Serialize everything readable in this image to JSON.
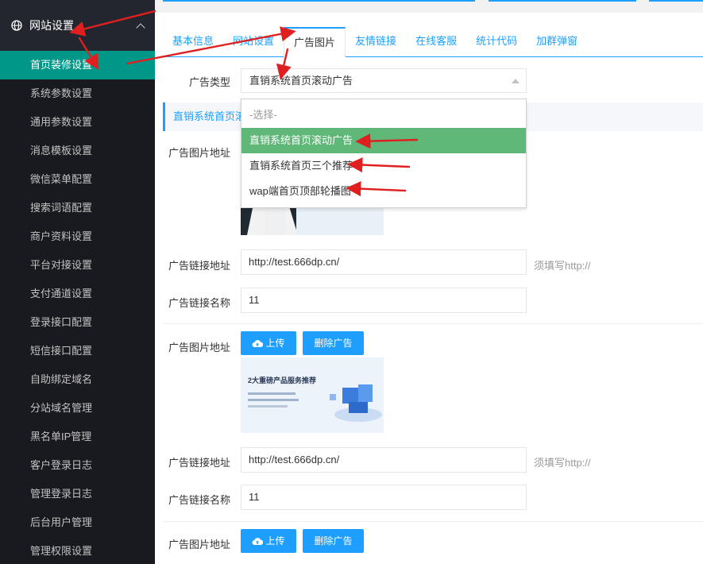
{
  "sidebar": {
    "group_label": "网站设置",
    "items": [
      {
        "label": "首页装修设置",
        "active": true
      },
      {
        "label": "系统参数设置"
      },
      {
        "label": "通用参数设置"
      },
      {
        "label": "消息模板设置"
      },
      {
        "label": "微信菜单配置"
      },
      {
        "label": "搜索词语配置"
      },
      {
        "label": "商户资料设置"
      },
      {
        "label": "平台对接设置"
      },
      {
        "label": "支付通道设置"
      },
      {
        "label": "登录接口配置"
      },
      {
        "label": "短信接口配置"
      },
      {
        "label": "自助绑定域名"
      },
      {
        "label": "分站域名管理"
      },
      {
        "label": "黑名单IP管理"
      },
      {
        "label": "客户登录日志"
      },
      {
        "label": "管理登录日志"
      },
      {
        "label": "后台用户管理"
      },
      {
        "label": "管理权限设置"
      }
    ]
  },
  "tabs": [
    {
      "label": "基本信息"
    },
    {
      "label": "网站设置"
    },
    {
      "label": "广告图片",
      "active": true
    },
    {
      "label": "友情链接"
    },
    {
      "label": "在线客服"
    },
    {
      "label": "统计代码"
    },
    {
      "label": "加群弹窗"
    }
  ],
  "form": {
    "ad_type_label": "广告类型",
    "ad_type_value": "直销系统首页滚动广告",
    "dropdown_options": [
      "-选择-",
      "直销系统首页滚动广告",
      "直销系统首页三个推荐",
      "wap端首页顶部轮播图"
    ],
    "section_title": "直销系统首页滚动广告",
    "entries": [
      {
        "image_label": "广告图片地址",
        "link_label": "广告链接地址",
        "link_value": "http://test.666dp.cn/",
        "link_hint": "须填写http://",
        "name_label": "广告链接名称",
        "name_value": "11"
      },
      {
        "image_label": "广告图片地址",
        "upload_label": "上传",
        "delete_label": "删除广告",
        "image_text": "2大重磅产品服务推荐",
        "link_label": "广告链接地址",
        "link_value": "http://test.666dp.cn/",
        "link_hint": "须填写http://",
        "name_label": "广告链接名称",
        "name_value": "11"
      },
      {
        "image_label": "广告图片地址",
        "upload_label": "上传",
        "delete_label": "删除广告"
      }
    ]
  },
  "colors": {
    "sidebar_bg": "#23262e",
    "active_item": "#009688",
    "accent": "#1e9fff",
    "option_selected": "#5fb878",
    "arrow": "#e02020"
  }
}
